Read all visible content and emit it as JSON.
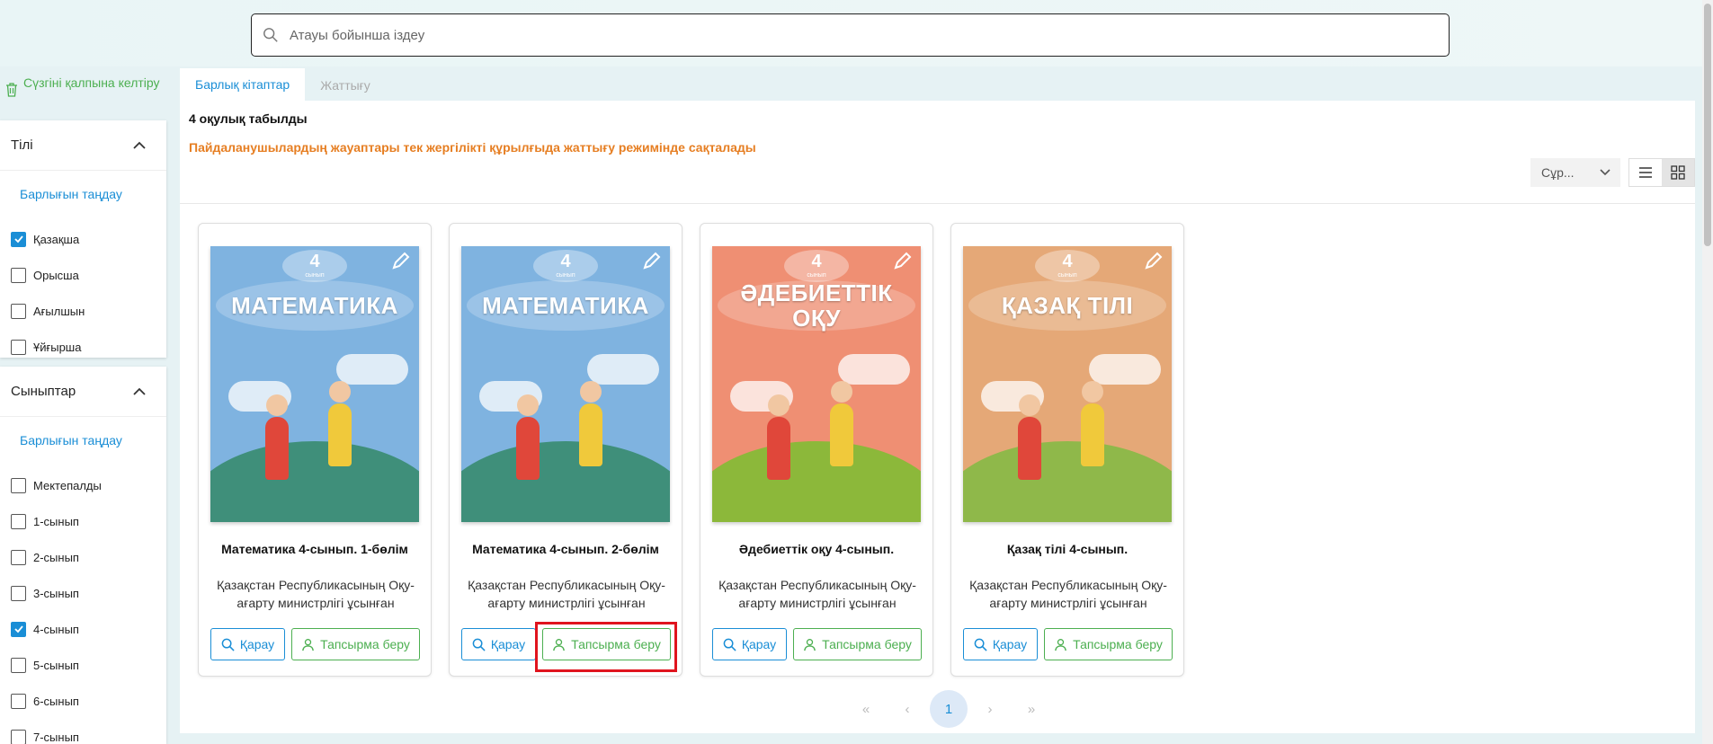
{
  "search": {
    "placeholder": "Атауы бойынша іздеу"
  },
  "sidebar": {
    "reset_label": "Сүзгіні қалпына келтіру",
    "language": {
      "title": "Тілі",
      "select_all": "Барлығын таңдау",
      "options": [
        {
          "label": "Қазақша",
          "checked": true
        },
        {
          "label": "Орысша",
          "checked": false
        },
        {
          "label": "Ағылшын",
          "checked": false
        },
        {
          "label": "Ұйғырша",
          "checked": false
        }
      ]
    },
    "grades": {
      "title": "Сыныптар",
      "select_all": "Барлығын таңдау",
      "options": [
        {
          "label": "Мектепалды",
          "checked": false
        },
        {
          "label": "1-сынып",
          "checked": false
        },
        {
          "label": "2-сынып",
          "checked": false
        },
        {
          "label": "3-сынып",
          "checked": false
        },
        {
          "label": "4-сынып",
          "checked": true
        },
        {
          "label": "5-сынып",
          "checked": false
        },
        {
          "label": "6-сынып",
          "checked": false
        },
        {
          "label": "7-сынып",
          "checked": false
        }
      ]
    }
  },
  "tabs": [
    {
      "label": "Барлық кітаптар",
      "active": true
    },
    {
      "label": "Жаттығу",
      "active": false
    }
  ],
  "main": {
    "found_text": "4 оқулық табылды",
    "notice": "Пайдаланушылардың жауаптары тек жергілікті құрылғыда жаттығу режимінде сақталады",
    "sort_label": "Сұр...",
    "view_mode": "grid"
  },
  "books": [
    {
      "title": "Математика 4-сынып. 1-бөлім",
      "description": "Қазақстан Республикасының Оқу-ағарту министрлігі ұсынған",
      "cover_title": "МАТЕМАТИКА",
      "grade": "4",
      "grade_caption": "сынып",
      "cover_color": "#7fb3e0",
      "ground_color": "#3f8f7a",
      "view_label": "Қарау",
      "assign_label": "Тапсырма беру"
    },
    {
      "title": "Математика 4-сынып. 2-бөлім",
      "description": "Қазақстан Республикасының Оқу-ағарту министрлігі ұсынған",
      "cover_title": "МАТЕМАТИКА",
      "grade": "4",
      "grade_caption": "сынып",
      "cover_color": "#7fb3e0",
      "ground_color": "#3f8f7a",
      "view_label": "Қарау",
      "assign_label": "Тапсырма беру"
    },
    {
      "title": "Әдебиеттік оқу 4-сынып.",
      "description": "Қазақстан Республикасының Оқу-ағарту министрлігі ұсынған",
      "cover_title": "ӘДЕБИЕТТІК ОҚУ",
      "grade": "4",
      "grade_caption": "сынып",
      "cover_color": "#ef8f73",
      "ground_color": "#8cb83a",
      "view_label": "Қарау",
      "assign_label": "Тапсырма беру"
    },
    {
      "title": "Қазақ тілі 4-сынып.",
      "description": "Қазақстан Республикасының Оқу-ағарту министрлігі ұсынған",
      "cover_title": "ҚАЗАҚ ТІЛІ",
      "grade": "4",
      "grade_caption": "сынып",
      "cover_color": "#e5a877",
      "ground_color": "#8fb84a",
      "view_label": "Қарау",
      "assign_label": "Тапсырма беру"
    }
  ],
  "pagination": {
    "current_page": "1",
    "first": "«",
    "prev": "‹",
    "next": "›",
    "last": "»"
  },
  "colors": {
    "primary": "#1a8ed6",
    "success": "#4caf50",
    "warning": "#e67e22",
    "highlight": "#e0141e"
  }
}
